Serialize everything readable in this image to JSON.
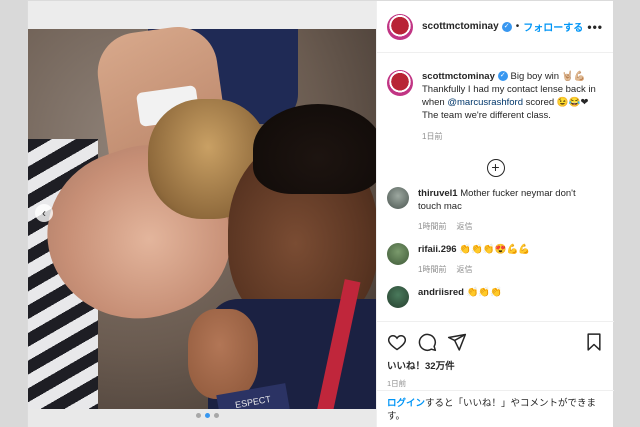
{
  "post": {
    "author": "scottmctominay",
    "follow_label": "フォローする",
    "separator": "•",
    "more_label": "•••",
    "caption": {
      "username": "scottmctominay",
      "text_part1": " Big boy win 🤘🏼💪🏼 Thankfully I had my contact lense back in when ",
      "mention": "@marcusrashford",
      "text_part2": " scored 😉😂❤ The team we're different class.",
      "time": "1日前"
    },
    "load_more_symbol": "+",
    "comments": [
      {
        "username": "thiruvel1",
        "text": "Mother fucker neymar don't touch mac",
        "time": "1時間前",
        "reply": "返信"
      },
      {
        "username": "rifaii.296",
        "text": "👏👏👏😍💪💪",
        "time": "1時間前",
        "reply": "返信"
      },
      {
        "username": "andriisred",
        "text": "👏👏👏",
        "time": "",
        "reply": ""
      }
    ],
    "likes": "いいね！32万件",
    "post_time": "1日前",
    "login_prompt": {
      "link": "ログイン",
      "text": "すると「いいね！」やコメントができます。"
    },
    "photo_badge": "ESPECT",
    "carousel_prev": "‹"
  },
  "colors": {
    "accent": "#0095f6",
    "verified": "#3897f0",
    "meta_gray": "#8e8e8e"
  },
  "icons": {
    "like": "heart-icon",
    "comment": "comment-icon",
    "share": "paper-plane-icon",
    "save": "bookmark-icon",
    "verified": "verified-badge-icon"
  }
}
